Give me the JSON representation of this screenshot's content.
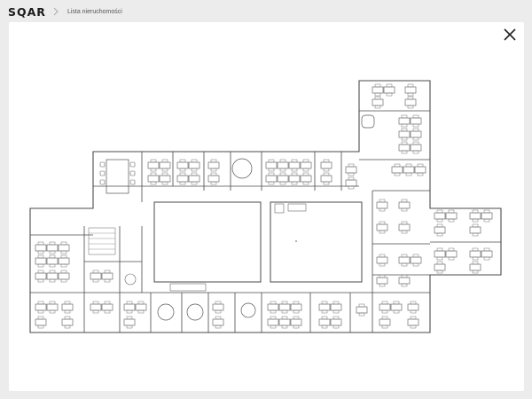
{
  "header": {
    "logo_text": "SQAR",
    "breadcrumb_label": "Lista nieruchomości"
  },
  "icons": {
    "close": "close-icon",
    "breadcrumb_separator": "chevron-right-icon"
  },
  "colors": {
    "background": "#ececec",
    "panel": "#ffffff",
    "plan_lines": "#4a4a4a"
  }
}
